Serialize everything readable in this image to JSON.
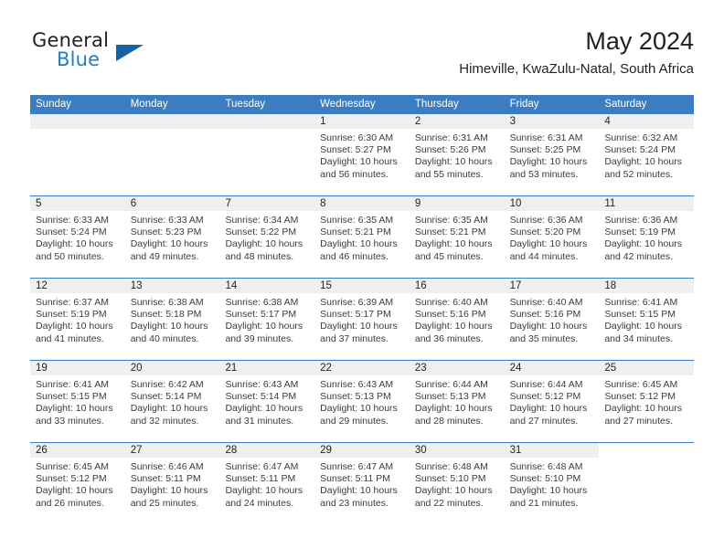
{
  "brand": {
    "name_top": "General",
    "name_bottom": "Blue",
    "accent_color": "#1464a5",
    "text_color": "#1f7ec4"
  },
  "header": {
    "month_title": "May 2024",
    "location": "Himeville, KwaZulu-Natal, South Africa"
  },
  "theme": {
    "header_bar_color": "#3b7dc0",
    "daynum_band_color": "#efefef",
    "text_color": "#231f20"
  },
  "weekdays": [
    "Sunday",
    "Monday",
    "Tuesday",
    "Wednesday",
    "Thursday",
    "Friday",
    "Saturday"
  ],
  "weeks": [
    [
      {
        "day": "",
        "blank": true,
        "sunrise": "",
        "sunset": "",
        "daylight1": "",
        "daylight2": ""
      },
      {
        "day": "",
        "blank": true,
        "sunrise": "",
        "sunset": "",
        "daylight1": "",
        "daylight2": ""
      },
      {
        "day": "",
        "blank": true,
        "sunrise": "",
        "sunset": "",
        "daylight1": "",
        "daylight2": ""
      },
      {
        "day": "1",
        "sunrise": "Sunrise: 6:30 AM",
        "sunset": "Sunset: 5:27 PM",
        "daylight1": "Daylight: 10 hours",
        "daylight2": "and 56 minutes."
      },
      {
        "day": "2",
        "sunrise": "Sunrise: 6:31 AM",
        "sunset": "Sunset: 5:26 PM",
        "daylight1": "Daylight: 10 hours",
        "daylight2": "and 55 minutes."
      },
      {
        "day": "3",
        "sunrise": "Sunrise: 6:31 AM",
        "sunset": "Sunset: 5:25 PM",
        "daylight1": "Daylight: 10 hours",
        "daylight2": "and 53 minutes."
      },
      {
        "day": "4",
        "sunrise": "Sunrise: 6:32 AM",
        "sunset": "Sunset: 5:24 PM",
        "daylight1": "Daylight: 10 hours",
        "daylight2": "and 52 minutes."
      }
    ],
    [
      {
        "day": "5",
        "sunrise": "Sunrise: 6:33 AM",
        "sunset": "Sunset: 5:24 PM",
        "daylight1": "Daylight: 10 hours",
        "daylight2": "and 50 minutes."
      },
      {
        "day": "6",
        "sunrise": "Sunrise: 6:33 AM",
        "sunset": "Sunset: 5:23 PM",
        "daylight1": "Daylight: 10 hours",
        "daylight2": "and 49 minutes."
      },
      {
        "day": "7",
        "sunrise": "Sunrise: 6:34 AM",
        "sunset": "Sunset: 5:22 PM",
        "daylight1": "Daylight: 10 hours",
        "daylight2": "and 48 minutes."
      },
      {
        "day": "8",
        "sunrise": "Sunrise: 6:35 AM",
        "sunset": "Sunset: 5:21 PM",
        "daylight1": "Daylight: 10 hours",
        "daylight2": "and 46 minutes."
      },
      {
        "day": "9",
        "sunrise": "Sunrise: 6:35 AM",
        "sunset": "Sunset: 5:21 PM",
        "daylight1": "Daylight: 10 hours",
        "daylight2": "and 45 minutes."
      },
      {
        "day": "10",
        "sunrise": "Sunrise: 6:36 AM",
        "sunset": "Sunset: 5:20 PM",
        "daylight1": "Daylight: 10 hours",
        "daylight2": "and 44 minutes."
      },
      {
        "day": "11",
        "sunrise": "Sunrise: 6:36 AM",
        "sunset": "Sunset: 5:19 PM",
        "daylight1": "Daylight: 10 hours",
        "daylight2": "and 42 minutes."
      }
    ],
    [
      {
        "day": "12",
        "sunrise": "Sunrise: 6:37 AM",
        "sunset": "Sunset: 5:19 PM",
        "daylight1": "Daylight: 10 hours",
        "daylight2": "and 41 minutes."
      },
      {
        "day": "13",
        "sunrise": "Sunrise: 6:38 AM",
        "sunset": "Sunset: 5:18 PM",
        "daylight1": "Daylight: 10 hours",
        "daylight2": "and 40 minutes."
      },
      {
        "day": "14",
        "sunrise": "Sunrise: 6:38 AM",
        "sunset": "Sunset: 5:17 PM",
        "daylight1": "Daylight: 10 hours",
        "daylight2": "and 39 minutes."
      },
      {
        "day": "15",
        "sunrise": "Sunrise: 6:39 AM",
        "sunset": "Sunset: 5:17 PM",
        "daylight1": "Daylight: 10 hours",
        "daylight2": "and 37 minutes."
      },
      {
        "day": "16",
        "sunrise": "Sunrise: 6:40 AM",
        "sunset": "Sunset: 5:16 PM",
        "daylight1": "Daylight: 10 hours",
        "daylight2": "and 36 minutes."
      },
      {
        "day": "17",
        "sunrise": "Sunrise: 6:40 AM",
        "sunset": "Sunset: 5:16 PM",
        "daylight1": "Daylight: 10 hours",
        "daylight2": "and 35 minutes."
      },
      {
        "day": "18",
        "sunrise": "Sunrise: 6:41 AM",
        "sunset": "Sunset: 5:15 PM",
        "daylight1": "Daylight: 10 hours",
        "daylight2": "and 34 minutes."
      }
    ],
    [
      {
        "day": "19",
        "sunrise": "Sunrise: 6:41 AM",
        "sunset": "Sunset: 5:15 PM",
        "daylight1": "Daylight: 10 hours",
        "daylight2": "and 33 minutes."
      },
      {
        "day": "20",
        "sunrise": "Sunrise: 6:42 AM",
        "sunset": "Sunset: 5:14 PM",
        "daylight1": "Daylight: 10 hours",
        "daylight2": "and 32 minutes."
      },
      {
        "day": "21",
        "sunrise": "Sunrise: 6:43 AM",
        "sunset": "Sunset: 5:14 PM",
        "daylight1": "Daylight: 10 hours",
        "daylight2": "and 31 minutes."
      },
      {
        "day": "22",
        "sunrise": "Sunrise: 6:43 AM",
        "sunset": "Sunset: 5:13 PM",
        "daylight1": "Daylight: 10 hours",
        "daylight2": "and 29 minutes."
      },
      {
        "day": "23",
        "sunrise": "Sunrise: 6:44 AM",
        "sunset": "Sunset: 5:13 PM",
        "daylight1": "Daylight: 10 hours",
        "daylight2": "and 28 minutes."
      },
      {
        "day": "24",
        "sunrise": "Sunrise: 6:44 AM",
        "sunset": "Sunset: 5:12 PM",
        "daylight1": "Daylight: 10 hours",
        "daylight2": "and 27 minutes."
      },
      {
        "day": "25",
        "sunrise": "Sunrise: 6:45 AM",
        "sunset": "Sunset: 5:12 PM",
        "daylight1": "Daylight: 10 hours",
        "daylight2": "and 27 minutes."
      }
    ],
    [
      {
        "day": "26",
        "sunrise": "Sunrise: 6:45 AM",
        "sunset": "Sunset: 5:12 PM",
        "daylight1": "Daylight: 10 hours",
        "daylight2": "and 26 minutes."
      },
      {
        "day": "27",
        "sunrise": "Sunrise: 6:46 AM",
        "sunset": "Sunset: 5:11 PM",
        "daylight1": "Daylight: 10 hours",
        "daylight2": "and 25 minutes."
      },
      {
        "day": "28",
        "sunrise": "Sunrise: 6:47 AM",
        "sunset": "Sunset: 5:11 PM",
        "daylight1": "Daylight: 10 hours",
        "daylight2": "and 24 minutes."
      },
      {
        "day": "29",
        "sunrise": "Sunrise: 6:47 AM",
        "sunset": "Sunset: 5:11 PM",
        "daylight1": "Daylight: 10 hours",
        "daylight2": "and 23 minutes."
      },
      {
        "day": "30",
        "sunrise": "Sunrise: 6:48 AM",
        "sunset": "Sunset: 5:10 PM",
        "daylight1": "Daylight: 10 hours",
        "daylight2": "and 22 minutes."
      },
      {
        "day": "31",
        "sunrise": "Sunrise: 6:48 AM",
        "sunset": "Sunset: 5:10 PM",
        "daylight1": "Daylight: 10 hours",
        "daylight2": "and 21 minutes."
      },
      {
        "day": "",
        "void": true,
        "sunrise": "",
        "sunset": "",
        "daylight1": "",
        "daylight2": ""
      }
    ]
  ]
}
